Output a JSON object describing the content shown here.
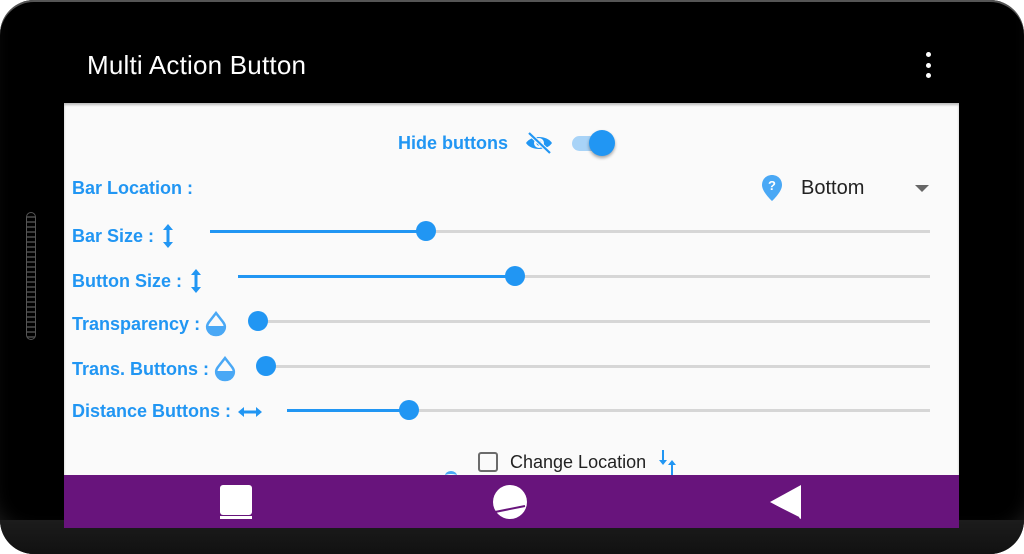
{
  "app": {
    "title": "Multi Action Button",
    "overflow_icon": "more-vert-icon"
  },
  "hide_buttons": {
    "label": "Hide buttons",
    "icon": "eye-off-icon",
    "enabled": true
  },
  "bar_location": {
    "label": "Bar Location :",
    "icon": "location-help-icon",
    "selected": "Bottom"
  },
  "sliders": [
    {
      "label": "Bar Size :",
      "icon": "vertical-resize-icon",
      "value_percent": 30
    },
    {
      "label": "Button Size :",
      "icon": "vertical-resize-icon",
      "value_percent": 40
    },
    {
      "label": "Transparency :",
      "icon": "water-drop-half-icon",
      "value_percent": 0
    },
    {
      "label": "Trans. Buttons :",
      "icon": "water-drop-half-icon",
      "value_percent": 0
    },
    {
      "label": "Distance Buttons :",
      "icon": "horizontal-resize-icon",
      "value_percent": 19
    }
  ],
  "change_location": {
    "label": "Change Location",
    "checked": false,
    "icon": "swap-vertical-icon"
  },
  "navbar": {
    "color": "#68147c",
    "buttons": [
      {
        "name": "recents",
        "icon": "recents-icon"
      },
      {
        "name": "home",
        "icon": "home-icon"
      },
      {
        "name": "back",
        "icon": "back-icon"
      }
    ]
  },
  "colors": {
    "accent": "#2196f3",
    "switch_track": "#a8d3f7",
    "rail": "#d6d6d6"
  }
}
